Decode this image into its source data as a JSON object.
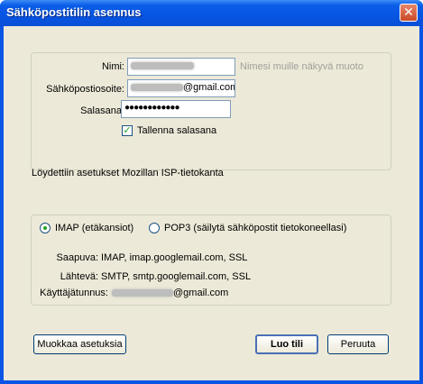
{
  "window": {
    "title": "Sähköpostitilin asennus",
    "close_glyph": "✕"
  },
  "account": {
    "name_label": "Nimi:",
    "email_label": "Sähköpostiosoite:",
    "password_label": "Salasana:",
    "name_hint": "Nimesi muille näkyvä muoto",
    "email_suffix": "@gmail.com",
    "password_value": "●●●●●●●●●●●●",
    "remember_password_label": "Tallenna salasana",
    "remember_password_checked": true
  },
  "status_text": "Löydettiin asetukset Mozillan ISP-tietokanta",
  "server": {
    "imap_label": "IMAP (etäkansiot)",
    "pop3_label": "POP3 (säilytä sähköpostit tietokoneellasi)",
    "selected": "imap",
    "incoming_label": "Saapuva:",
    "incoming_value": "IMAP, imap.googlemail.com, SSL",
    "outgoing_label": "Lähtevä:",
    "outgoing_value": "SMTP, smtp.googlemail.com, SSL",
    "username_label": "Käyttäjätunnus:",
    "username_suffix": "@gmail.com"
  },
  "buttons": {
    "edit_settings": "Muokkaa asetuksia",
    "create_account": "Luo tili",
    "cancel": "Peruuta"
  },
  "colors": {
    "titlebar": "#0754e3",
    "dialog_bg": "#ece9d8",
    "check": "#21a121"
  }
}
